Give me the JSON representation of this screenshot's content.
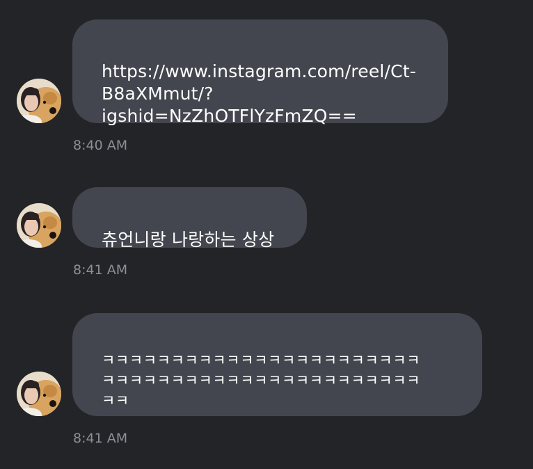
{
  "messages": [
    {
      "text": "https://www.instagram.com/reel/Ct-\nB8aXMmut/?\nigshid=NzZhOTFlYzFmZQ==",
      "time": "8:40 AM",
      "avatar_icon": "profile-photo-with-dog"
    },
    {
      "text": "츄언니랑 나랑하는 상상",
      "time": "8:41 AM",
      "avatar_icon": "profile-photo-with-dog"
    },
    {
      "text": "ㅋㅋㅋㅋㅋㅋㅋㅋㅋㅋㅋㅋㅋㅋㅋㅋㅋㅋㅋㅋㅋㅋㅋ\nㅋㅋㅋㅋㅋㅋㅋㅋㅋㅋㅋㅋㅋㅋㅋㅋㅋㅋㅋㅋㅋㅋㅋ\nㅋㅋ",
      "time": "8:41 AM",
      "avatar_icon": "profile-photo-with-dog"
    }
  ],
  "colors": {
    "background": "#232427",
    "bubble": "#44464f",
    "text": "#ffffff",
    "timestamp": "#8d8f96"
  }
}
